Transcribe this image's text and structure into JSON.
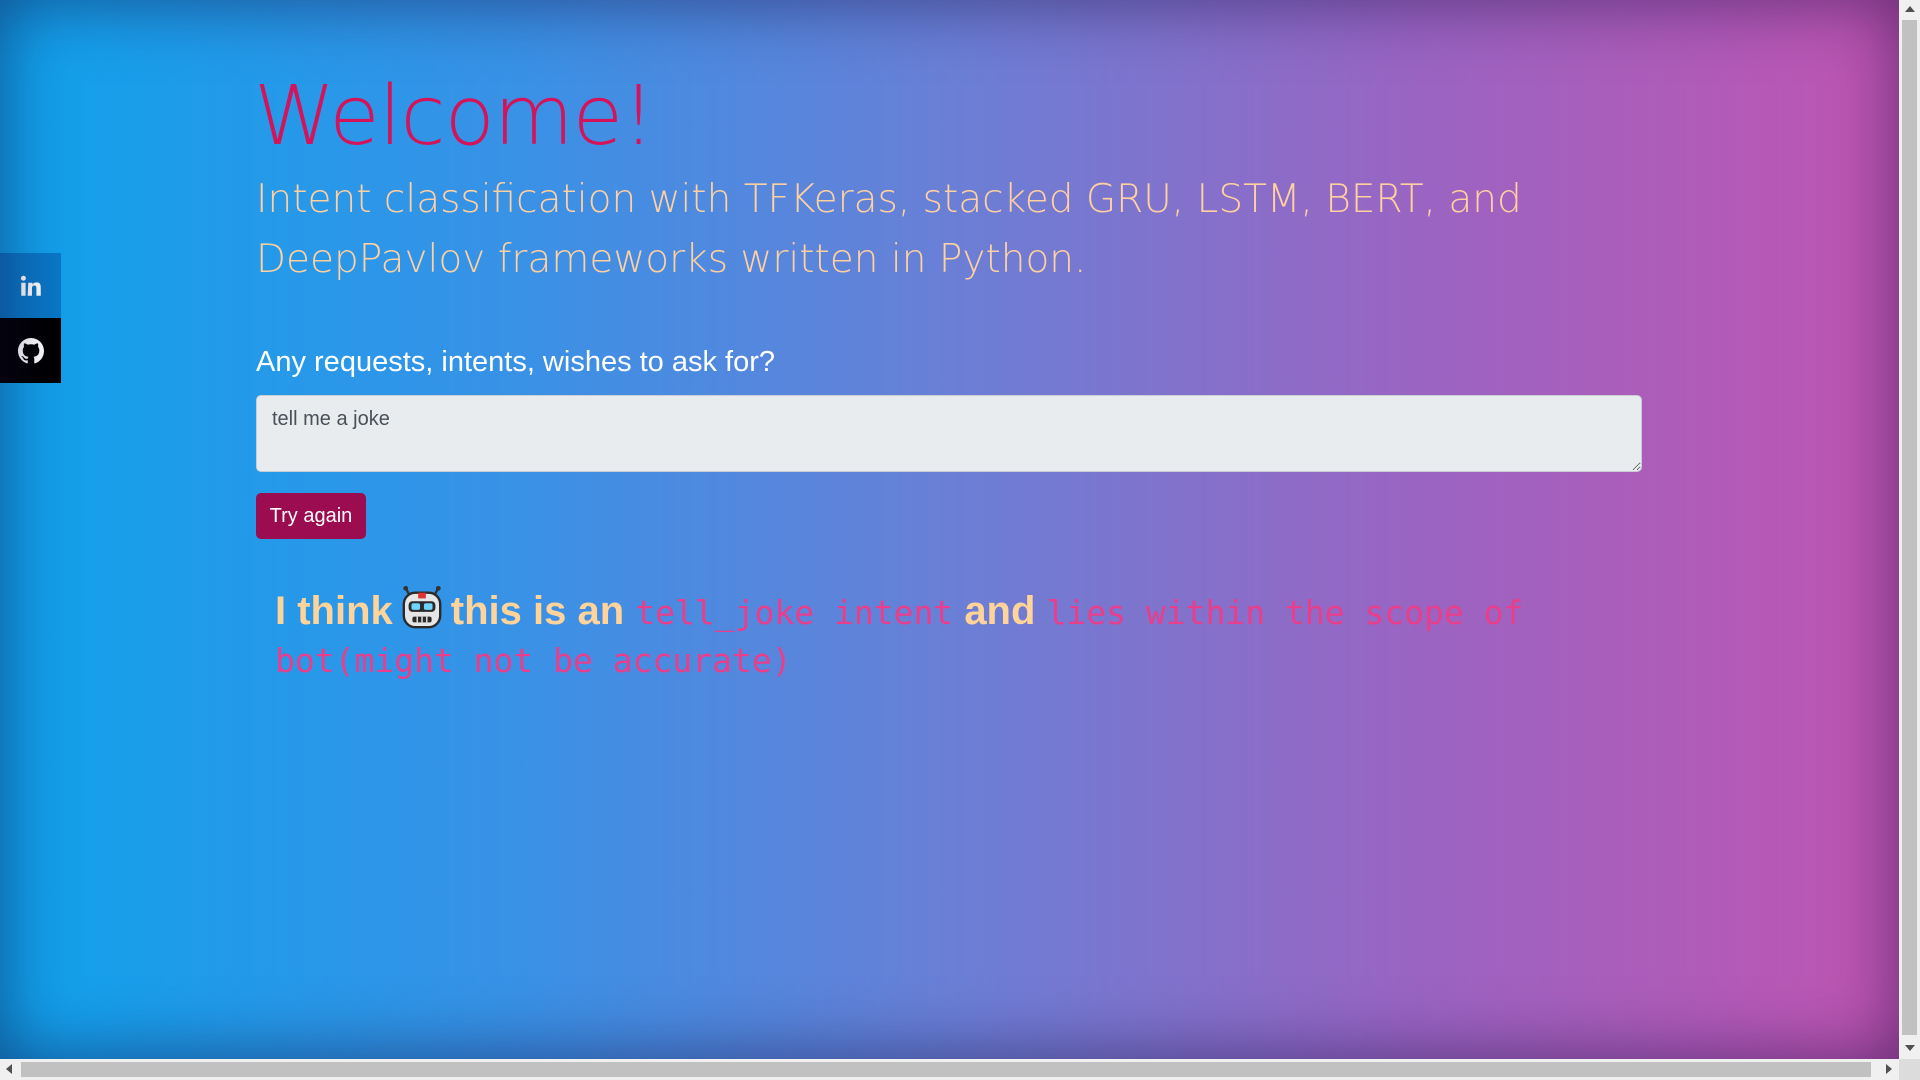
{
  "social": [
    {
      "name": "linkedin",
      "icon": "linkedin-icon"
    },
    {
      "name": "github",
      "icon": "github-icon"
    }
  ],
  "hero": {
    "title": "Welcome!",
    "subtitle": "Intent classification with TFKeras, stacked GRU, LSTM, BERT, and DeepPavlov frameworks written in Python."
  },
  "form": {
    "question": "Any requests, intents, wishes to ask for?",
    "query_value": "tell me a joke",
    "submit_label": "Try again"
  },
  "result": {
    "prefix": "I think",
    "bot_icon": "robot-face-icon",
    "mid": "this is an",
    "intent": "tell_joke intent",
    "conj": "and",
    "scope": "lies within the scope of bot(might not be accurate)"
  },
  "colors": {
    "title": "#d3145a",
    "subtitle": "#ffd0a0",
    "button": "#9b0c50",
    "code_text": "#e83e8c",
    "result_text": "#ffd39a",
    "gradient_start": "#0fa2ec",
    "gradient_end": "#c055b2",
    "linkedin_bg": "#0a78c7",
    "github_bg": "#000000"
  }
}
